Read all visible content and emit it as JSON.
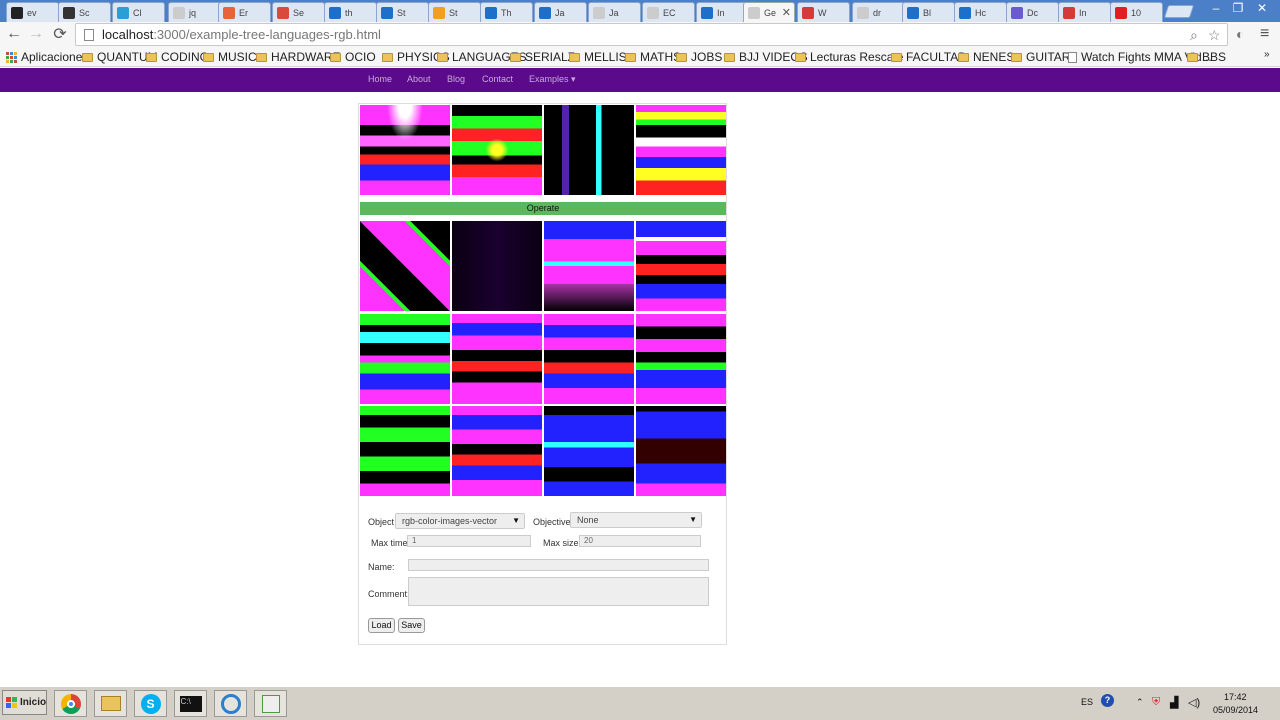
{
  "tabs": [
    {
      "label": "ev",
      "color": "#222222"
    },
    {
      "label": "Sc",
      "color": "#333333"
    },
    {
      "label": "Cl",
      "color": "#2a9fd6"
    },
    {
      "label": "jq",
      "color": "#cccccc"
    },
    {
      "label": "Er",
      "color": "#e8623a"
    },
    {
      "label": "Se",
      "color": "#d94a3d"
    },
    {
      "label": "th",
      "color": "#1e6fc9"
    },
    {
      "label": "St",
      "color": "#1e6fc9"
    },
    {
      "label": "St",
      "color": "#f0a020"
    },
    {
      "label": "Th",
      "color": "#1e6fc9"
    },
    {
      "label": "Ja",
      "color": "#1e6fc9"
    },
    {
      "label": "Ja",
      "color": "#cccccc"
    },
    {
      "label": "EC",
      "color": "#cccccc"
    },
    {
      "label": "In",
      "color": "#1e6fc9"
    },
    {
      "label": "Ge",
      "color": "#cccccc",
      "active": true
    },
    {
      "label": "W",
      "color": "#d43a3a"
    },
    {
      "label": "dr",
      "color": "#cccccc"
    },
    {
      "label": "Bl",
      "color": "#1e6fc9"
    },
    {
      "label": "Hc",
      "color": "#1e6fc9"
    },
    {
      "label": "Dc",
      "color": "#6a5ad0"
    },
    {
      "label": "In",
      "color": "#d43a3a"
    },
    {
      "label": "10",
      "color": "#e02020"
    }
  ],
  "active_tab_close": "✕",
  "window_controls": {
    "minimize": "–",
    "maximize": "❐",
    "close": "✕"
  },
  "toolbar": {
    "back": "←",
    "forward": "→",
    "reload": "⟳",
    "url_host": "localhost",
    "url_path": ":3000/example-tree-languages-rgb.html",
    "search_icon": "⌕",
    "star_icon": "☆",
    "menu_icon": "≡"
  },
  "bookmarks": [
    {
      "label": "Aplicaciones",
      "type": "apps"
    },
    {
      "label": "QUANTUM",
      "type": "folder"
    },
    {
      "label": "CODING",
      "type": "folder"
    },
    {
      "label": "MUSIC",
      "type": "folder"
    },
    {
      "label": "HARDWARE",
      "type": "folder"
    },
    {
      "label": "OCIO",
      "type": "folder"
    },
    {
      "label": "PHYSICS",
      "type": "folder"
    },
    {
      "label": "LANGUAGES",
      "type": "folder"
    },
    {
      "label": "SERIALZ",
      "type": "folder"
    },
    {
      "label": "MELLIS",
      "type": "folder"
    },
    {
      "label": "MATHS",
      "type": "folder"
    },
    {
      "label": "JOBS",
      "type": "folder"
    },
    {
      "label": "BJJ VIDEOS",
      "type": "folder"
    },
    {
      "label": "Lecturas Rescate",
      "type": "folder"
    },
    {
      "label": "FACULTAD",
      "type": "folder"
    },
    {
      "label": "NENES",
      "type": "folder"
    },
    {
      "label": "GUITAR",
      "type": "folder"
    },
    {
      "label": "Watch Fights MMA Vid...",
      "type": "page"
    },
    {
      "label": "BBS",
      "type": "folder"
    }
  ],
  "bookmarks_overflow": "»",
  "site_nav": [
    "Home",
    "About",
    "Blog",
    "Contact",
    "Examples ▾"
  ],
  "operate_label": "Operate",
  "form": {
    "object_label": "Object",
    "object_value": "rgb-color-images-vector",
    "objective_label": "Objective",
    "objective_value": "None",
    "max_time_label": "Max time",
    "max_time_value": "1",
    "max_size_label": "Max size",
    "max_size_value": "20",
    "name_label": "Name:",
    "name_value": "",
    "comment_label": "Comment:",
    "comment_value": "",
    "load_label": "Load",
    "save_label": "Save"
  },
  "taskbar": {
    "start_label": "Inicio",
    "language": "ES",
    "time": "17:42",
    "date": "05/09/2014"
  },
  "colors": {
    "tab_strip": "#4b7fc8",
    "site_nav": "#5a0a8a",
    "operate": "#5cb85c",
    "taskbar": "#d4d0c8"
  }
}
